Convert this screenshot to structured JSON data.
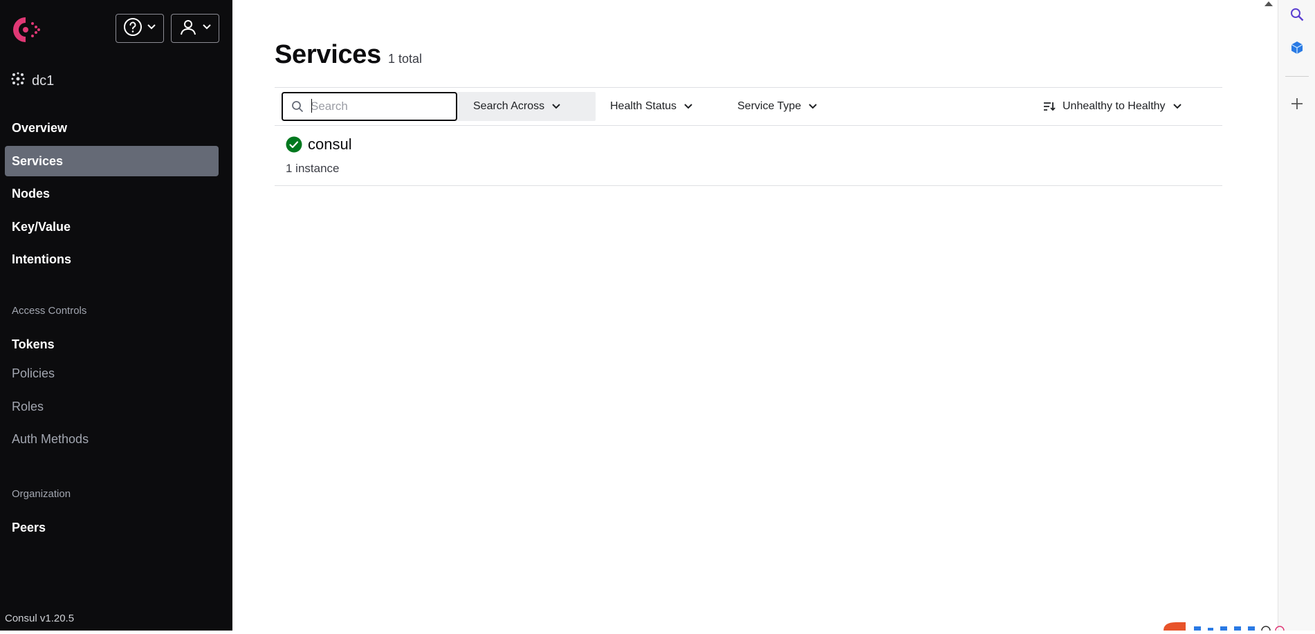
{
  "sidebar": {
    "datacenter": "dc1",
    "nav": [
      {
        "label": "Overview"
      },
      {
        "label": "Services"
      },
      {
        "label": "Nodes"
      },
      {
        "label": "Key/Value"
      },
      {
        "label": "Intentions"
      }
    ],
    "access_controls": {
      "heading": "Access Controls",
      "items": [
        {
          "label": "Tokens"
        },
        {
          "label": "Policies"
        },
        {
          "label": "Roles"
        },
        {
          "label": "Auth Methods"
        }
      ]
    },
    "organization": {
      "heading": "Organization",
      "items": [
        {
          "label": "Peers"
        }
      ]
    },
    "version": "Consul v1.20.5",
    "active_item": "Services"
  },
  "main": {
    "title": "Services",
    "count": "1 total",
    "filters": {
      "search_placeholder": "Search",
      "search_across": "Search Across",
      "health_status": "Health Status",
      "service_type": "Service Type",
      "sort": "Unhealthy to Healthy"
    },
    "services": [
      {
        "name": "consul",
        "instances": "1 instance",
        "status": "passing"
      }
    ]
  },
  "colors": {
    "sidebar_bg": "#0c0c0e",
    "active_bg": "#656a76",
    "brand": "#e03875",
    "healthy": "#00781e"
  },
  "icons": {
    "logo": "consul-logo",
    "help": "help-circle-icon",
    "user": "user-icon",
    "datacenter": "datacenter-icon",
    "search": "search-icon",
    "sort": "sort-icon",
    "health": "check-circle-icon"
  }
}
